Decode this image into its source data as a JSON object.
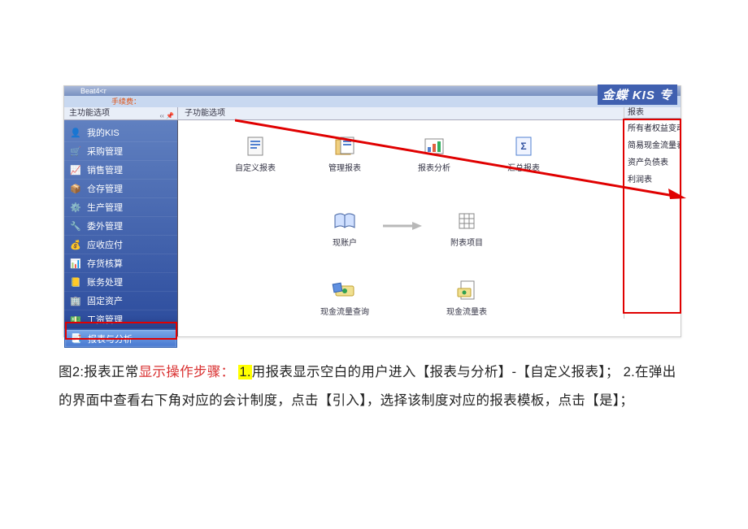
{
  "titlebar": {
    "text": "Beat4<r"
  },
  "menubar": {
    "hint": "手续费："
  },
  "panel_headers": {
    "left": "主功能选项",
    "mid": "子功能选项"
  },
  "sidebar": {
    "items": [
      {
        "label": "我的KIS",
        "icon": "👤",
        "hex": "#f0b030"
      },
      {
        "label": "采购管理",
        "icon": "🛒",
        "hex": "#f07030"
      },
      {
        "label": "销售管理",
        "icon": "📈",
        "hex": "#f0b030"
      },
      {
        "label": "仓存管理",
        "icon": "📦",
        "hex": "#c08030"
      },
      {
        "label": "生产管理",
        "icon": "⚙️",
        "hex": "#50a0f0"
      },
      {
        "label": "委外管理",
        "icon": "🔧",
        "hex": "#30c070"
      },
      {
        "label": "应收应付",
        "icon": "💰",
        "hex": "#f0d030"
      },
      {
        "label": "存货核算",
        "icon": "📊",
        "hex": "#e04040"
      },
      {
        "label": "账务处理",
        "icon": "📒",
        "hex": "#5080d0"
      },
      {
        "label": "固定资产",
        "icon": "🏢",
        "hex": "#40b0d0"
      },
      {
        "label": "工资管理",
        "icon": "💵",
        "hex": "#f0b030"
      },
      {
        "label": "报表与分析",
        "icon": "📑",
        "hex": "#40b0e0"
      }
    ],
    "active_index": 11
  },
  "content_tools": {
    "row1": [
      {
        "label": "自定义报表"
      },
      {
        "label": "管理报表"
      },
      {
        "label": "报表分析"
      },
      {
        "label": "汇总报表"
      }
    ],
    "row2": [
      {
        "label": "现账户"
      },
      {
        "label": "附表项目"
      }
    ],
    "row3": [
      {
        "label": "现金流量查询"
      },
      {
        "label": "现金流量表"
      }
    ]
  },
  "right_panel": {
    "header": "报表",
    "links": [
      "所有者权益变动表",
      "简易现金流量表",
      "资产负债表",
      "利润表"
    ]
  },
  "brand": {
    "text": "金蝶 KIS 专"
  },
  "caption": {
    "prefix": "图2:报表正常",
    "red": "显示操作步骤：",
    "hl": "1.",
    "part1": "用报表显示空白的用户进入【报表与分析】-【自定义报表】； 2.在弹出的界面中查看右下角对应的会计制度，点击【引入】，选择该制度对应的报表模板，点击【是】；"
  }
}
